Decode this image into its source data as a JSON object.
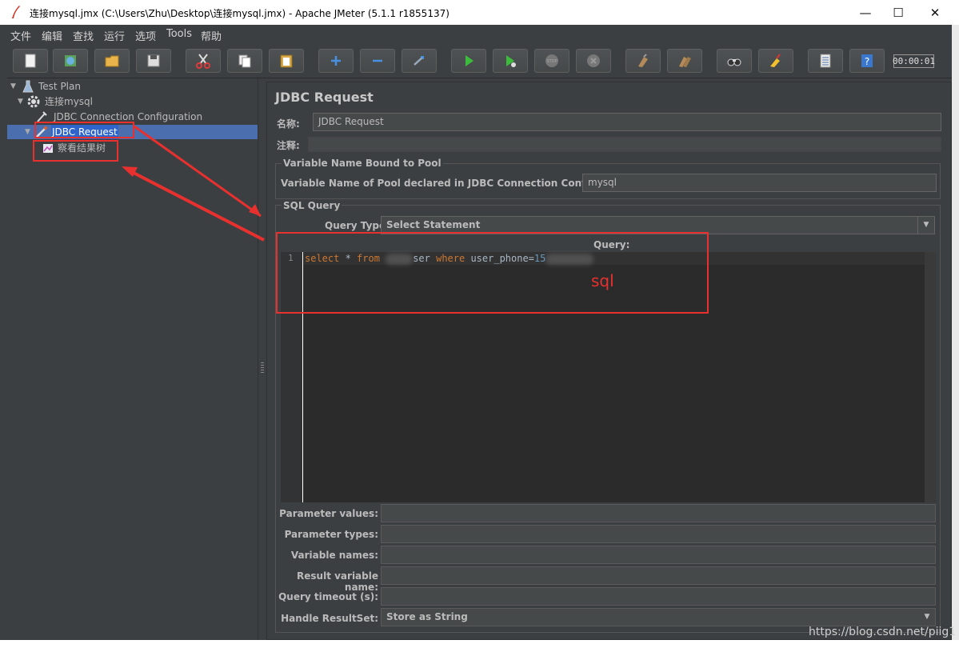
{
  "window": {
    "title": "连接mysql.jmx (C:\\Users\\Zhu\\Desktop\\连接mysql.jmx) - Apache JMeter (5.1.1 r1855137)",
    "minimize": "—",
    "maximize": "☐",
    "close": "✕"
  },
  "menu": [
    "文件",
    "编辑",
    "查找",
    "运行",
    "选项",
    "Tools",
    "帮助"
  ],
  "toolbar": {
    "buttons": [
      "new-icon",
      "templates-icon",
      "open-icon",
      "save-icon",
      "cut-icon",
      "copy-icon",
      "paste-icon",
      "expand-icon",
      "collapse-icon",
      "toggle-icon",
      "start-icon",
      "start-no-pause-icon",
      "stop-icon",
      "shutdown-icon",
      "clear-icon",
      "clear-all-icon",
      "search-icon",
      "reset-search-icon",
      "function-helper-icon",
      "help-icon"
    ],
    "timer": "00:00:01"
  },
  "tree": {
    "items": [
      {
        "label": "Test Plan",
        "icon": "test-plan-icon"
      },
      {
        "label": "连接mysql",
        "icon": "thread-group-icon"
      },
      {
        "label": "JDBC Connection Configuration",
        "icon": "config-icon"
      },
      {
        "label": "JDBC Request",
        "icon": "sampler-icon",
        "selected": true
      },
      {
        "label": "察看结果树",
        "icon": "listener-icon"
      }
    ]
  },
  "panel": {
    "title": "JDBC Request",
    "name_label": "名称:",
    "name_value": "JDBC Request",
    "comment_label": "注释:",
    "comment_value": "",
    "pool_group_title": "Variable Name Bound to Pool",
    "pool_label": "Variable Name of Pool declared in JDBC Connection Configuration:",
    "pool_value": "mysql",
    "sql_group_title": "SQL Query",
    "query_type_label": "Query Type:",
    "query_type_value": "Select Statement",
    "query_label": "Query:",
    "editor": {
      "line_number": "1",
      "kw_select": "select",
      "tx_star": " * ",
      "kw_from": "from",
      "tx_table": "ser ",
      "kw_where": "where",
      "tx_cond": " user_phone=",
      "num_val": "15"
    },
    "params": [
      {
        "label": "Parameter values:",
        "value": ""
      },
      {
        "label": "Parameter types:",
        "value": ""
      },
      {
        "label": "Variable names:",
        "value": ""
      },
      {
        "label": "Result variable name:",
        "value": ""
      },
      {
        "label": "Query timeout (s):",
        "value": ""
      },
      {
        "label": "Handle ResultSet:",
        "value": "Store as String"
      }
    ]
  },
  "annotation": {
    "sql_label": "sql",
    "color": "#e8312f"
  },
  "watermark": "https://blog.csdn.net/piig1"
}
